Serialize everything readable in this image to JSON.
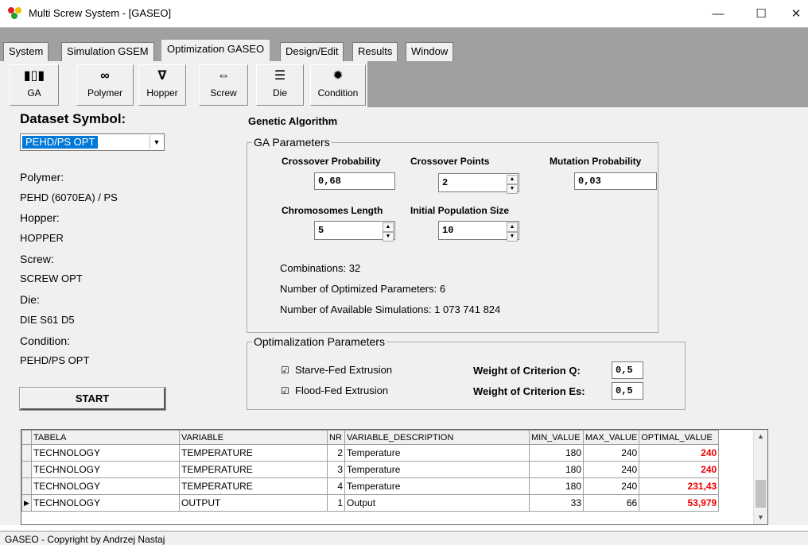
{
  "window": {
    "title": "Multi Screw System - [GASEO]",
    "controls": {
      "minimize": "—",
      "maximize": "☐",
      "close": "✕"
    }
  },
  "menu": {
    "tabs": [
      {
        "label": "System"
      },
      {
        "label": "Simulation GSEM"
      },
      {
        "label": "Optimization GASEO",
        "active": true
      },
      {
        "label": "Design/Edit"
      },
      {
        "label": "Results"
      },
      {
        "label": "Window"
      }
    ]
  },
  "toolbar": {
    "buttons": [
      {
        "label": "GA",
        "icon": "ga-icon",
        "glyph": "▮▯▮"
      },
      {
        "label": "Polymer",
        "icon": "polymer-icon",
        "glyph": "∞"
      },
      {
        "label": "Hopper",
        "icon": "hopper-icon",
        "glyph": "∇"
      },
      {
        "label": "Screw",
        "icon": "screw-icon",
        "glyph": "⇔"
      },
      {
        "label": "Die",
        "icon": "die-icon",
        "glyph": "☰"
      },
      {
        "label": "Condition",
        "icon": "gear-icon",
        "glyph": "✹"
      }
    ]
  },
  "left": {
    "dataset_title": "Dataset Symbol:",
    "dataset_value": "PEHD/PS OPT",
    "polymer_label": "Polymer:",
    "polymer_value": "PEHD (6070EA) / PS",
    "hopper_label": "Hopper:",
    "hopper_value": "HOPPER",
    "screw_label": "Screw:",
    "screw_value": "SCREW OPT",
    "die_label": "Die:",
    "die_value": "DIE S61 D5",
    "condition_label": "Condition:",
    "condition_value": "PEHD/PS OPT",
    "start_label": "START"
  },
  "ga": {
    "heading": "Genetic Algorithm",
    "group_title": "GA Parameters",
    "crossover_probability_label": "Crossover Probability",
    "crossover_probability_value": "0,68",
    "crossover_points_label": "Crossover Points",
    "crossover_points_value": "2",
    "mutation_probability_label": "Mutation Probability",
    "mutation_probability_value": "0,03",
    "chromosomes_length_label": "Chromosomes Length",
    "chromosomes_length_value": "5",
    "initial_population_label": "Initial Population Size",
    "initial_population_value": "10",
    "combinations": "Combinations: 32",
    "optimized_params": "Number of Optimized Parameters: 6",
    "available_sims": "Number of Available Simulations: 1 073 741 824"
  },
  "opt": {
    "group_title": "Optimalization Parameters",
    "starve_label": "Starve-Fed Extrusion",
    "starve_checked": true,
    "flood_label": "Flood-Fed Extrusion",
    "flood_checked": true,
    "weight_q_label": "Weight of Criterion Q:",
    "weight_q_value": "0,5",
    "weight_es_label": "Weight of Criterion Es:",
    "weight_es_value": "0,5"
  },
  "grid": {
    "columns": [
      "TABELA",
      "VARIABLE",
      "NR",
      "VARIABLE_DESCRIPTION",
      "MIN_VALUE",
      "MAX_VALUE",
      "OPTIMAL_VALUE"
    ],
    "rows": [
      {
        "tabela": "TECHNOLOGY",
        "variable": "TEMPERATURE",
        "nr": "2",
        "desc": "Temperature",
        "min": "180",
        "max": "240",
        "opt": "240",
        "current": false
      },
      {
        "tabela": "TECHNOLOGY",
        "variable": "TEMPERATURE",
        "nr": "3",
        "desc": "Temperature",
        "min": "180",
        "max": "240",
        "opt": "240",
        "current": false
      },
      {
        "tabela": "TECHNOLOGY",
        "variable": "TEMPERATURE",
        "nr": "4",
        "desc": "Temperature",
        "min": "180",
        "max": "240",
        "opt": "231,43",
        "current": false
      },
      {
        "tabela": "TECHNOLOGY",
        "variable": "OUTPUT",
        "nr": "1",
        "desc": "Output",
        "min": "33",
        "max": "66",
        "opt": "53,979",
        "current": true
      }
    ]
  },
  "status": {
    "text": "GASEO - Copyright by Andrzej Nastaj"
  }
}
